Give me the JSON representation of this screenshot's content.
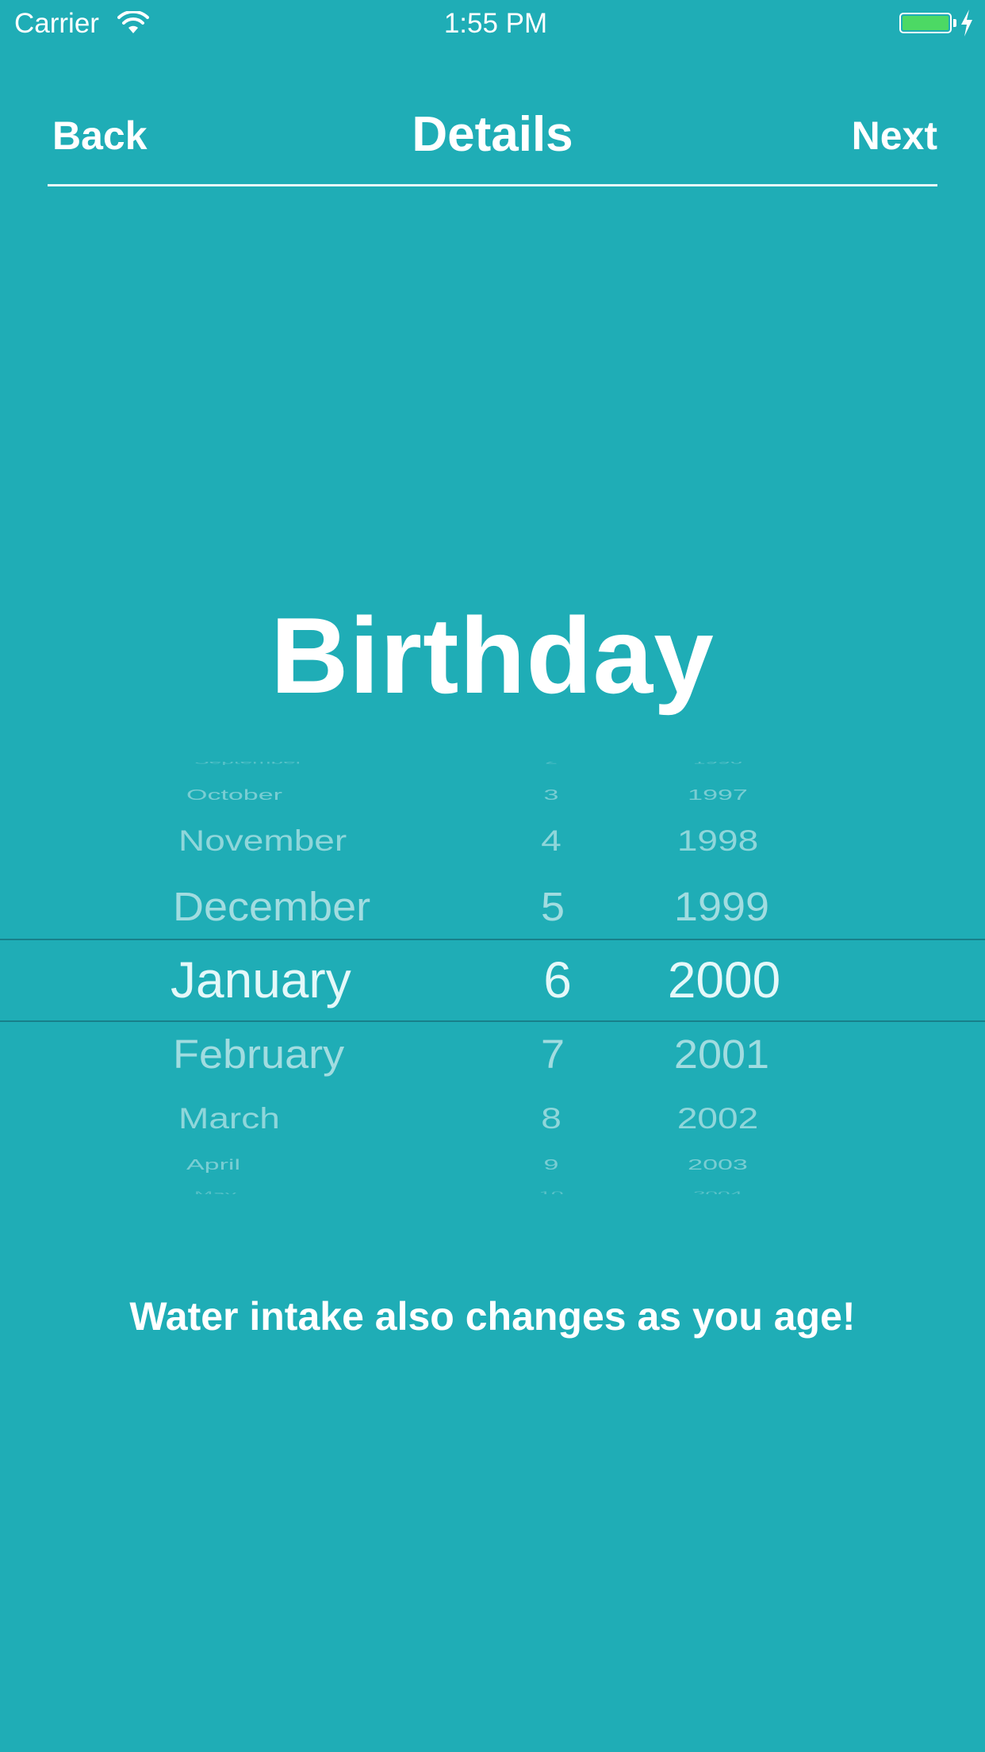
{
  "status_bar": {
    "carrier": "Carrier",
    "time": "1:55 PM",
    "wifi_icon": "wifi-icon",
    "battery_icon": "battery-icon",
    "charging_icon": "bolt-icon",
    "battery_color": "#4cd964"
  },
  "nav": {
    "back_label": "Back",
    "title": "Details",
    "next_label": "Next"
  },
  "headline": "Birthday",
  "picker": {
    "selected": {
      "month": "January",
      "day": "6",
      "year": "2000"
    },
    "rows": [
      {
        "month": "September",
        "day": "2",
        "year": "1996"
      },
      {
        "month": "October",
        "day": "3",
        "year": "1997"
      },
      {
        "month": "November",
        "day": "4",
        "year": "1998"
      },
      {
        "month": "December",
        "day": "5",
        "year": "1999"
      },
      {
        "month": "January",
        "day": "6",
        "year": "2000"
      },
      {
        "month": "February",
        "day": "7",
        "year": "2001"
      },
      {
        "month": "March",
        "day": "8",
        "year": "2002"
      },
      {
        "month": "April",
        "day": "9",
        "year": "2003"
      },
      {
        "month": "May",
        "day": "10",
        "year": "2004"
      }
    ]
  },
  "footer_text": "Water intake also changes as you age!",
  "colors": {
    "background": "#1fadb6",
    "text": "#ffffff",
    "picker_selected_text": "#e4f8f9",
    "picker_line": "#17808a"
  }
}
